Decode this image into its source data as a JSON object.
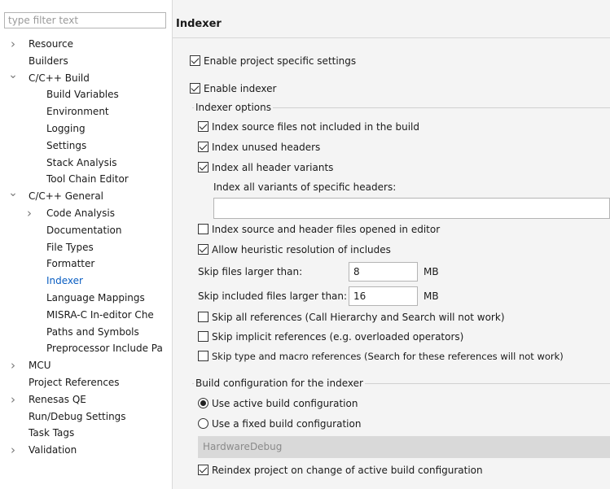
{
  "filter": {
    "placeholder": "type filter text"
  },
  "tree": [
    {
      "label": "Resource",
      "twisty": ">",
      "level": 0
    },
    {
      "label": "Builders",
      "twisty": "",
      "level": 0
    },
    {
      "label": "C/C++ Build",
      "twisty": "v",
      "level": 0
    },
    {
      "label": "Build Variables",
      "twisty": "",
      "level": 1
    },
    {
      "label": "Environment",
      "twisty": "",
      "level": 1
    },
    {
      "label": "Logging",
      "twisty": "",
      "level": 1
    },
    {
      "label": "Settings",
      "twisty": "",
      "level": 1
    },
    {
      "label": "Stack Analysis",
      "twisty": "",
      "level": 1
    },
    {
      "label": "Tool Chain Editor",
      "twisty": "",
      "level": 1
    },
    {
      "label": "C/C++ General",
      "twisty": "v",
      "level": 0
    },
    {
      "label": "Code Analysis",
      "twisty": ">",
      "level": 1
    },
    {
      "label": "Documentation",
      "twisty": "",
      "level": 1
    },
    {
      "label": "File Types",
      "twisty": "",
      "level": 1
    },
    {
      "label": "Formatter",
      "twisty": "",
      "level": 1
    },
    {
      "label": "Indexer",
      "twisty": "",
      "level": 1,
      "selected": true
    },
    {
      "label": "Language Mappings",
      "twisty": "",
      "level": 1
    },
    {
      "label": "MISRA-C In-editor Che",
      "twisty": "",
      "level": 1
    },
    {
      "label": "Paths and Symbols",
      "twisty": "",
      "level": 1
    },
    {
      "label": "Preprocessor Include Pa",
      "twisty": "",
      "level": 1
    },
    {
      "label": "MCU",
      "twisty": ">",
      "level": 0
    },
    {
      "label": "Project References",
      "twisty": "",
      "level": 0
    },
    {
      "label": "Renesas QE",
      "twisty": ">",
      "level": 0
    },
    {
      "label": "Run/Debug Settings",
      "twisty": "",
      "level": 0
    },
    {
      "label": "Task Tags",
      "twisty": "",
      "level": 0
    },
    {
      "label": "Validation",
      "twisty": ">",
      "level": 0
    }
  ],
  "page": {
    "title": "Indexer",
    "enable_project_specific": {
      "label": "Enable project specific settings",
      "checked": true
    },
    "enable_indexer": {
      "label": "Enable indexer",
      "checked": true
    },
    "indexer_options": {
      "label": "Indexer options",
      "index_source_not_in_build": {
        "label": "Index source files not included in the build",
        "checked": true
      },
      "index_unused_headers": {
        "label": "Index unused headers",
        "checked": true
      },
      "index_all_header_variants": {
        "label": "Index all header variants",
        "checked": true
      },
      "variants_specific_label": "Index all variants of specific headers:",
      "variants_specific_value": "",
      "index_opened_in_editor": {
        "label": "Index source and header files opened in editor",
        "checked": false
      },
      "heuristic_includes": {
        "label": "Allow heuristic resolution of includes",
        "checked": true
      },
      "skip_files_larger": {
        "label": "Skip files larger than:",
        "value": "8",
        "unit": "MB"
      },
      "skip_included_larger": {
        "label": "Skip included files larger than:",
        "value": "16",
        "unit": "MB"
      },
      "skip_all_refs": {
        "label": "Skip all references (Call Hierarchy and Search will not work)",
        "checked": false
      },
      "skip_implicit_refs": {
        "label": "Skip implicit references (e.g. overloaded operators)",
        "checked": false
      },
      "skip_type_macro_refs": {
        "label": "Skip type and macro references (Search for these references will not work)",
        "checked": false
      }
    },
    "build_config": {
      "label": "Build configuration for the indexer",
      "use_active": {
        "label": "Use active build configuration",
        "selected": true
      },
      "use_fixed": {
        "label": "Use a fixed build configuration",
        "selected": false
      },
      "fixed_value": "HardwareDebug",
      "reindex": {
        "label": "Reindex project on change of active build configuration",
        "checked": true
      }
    }
  }
}
